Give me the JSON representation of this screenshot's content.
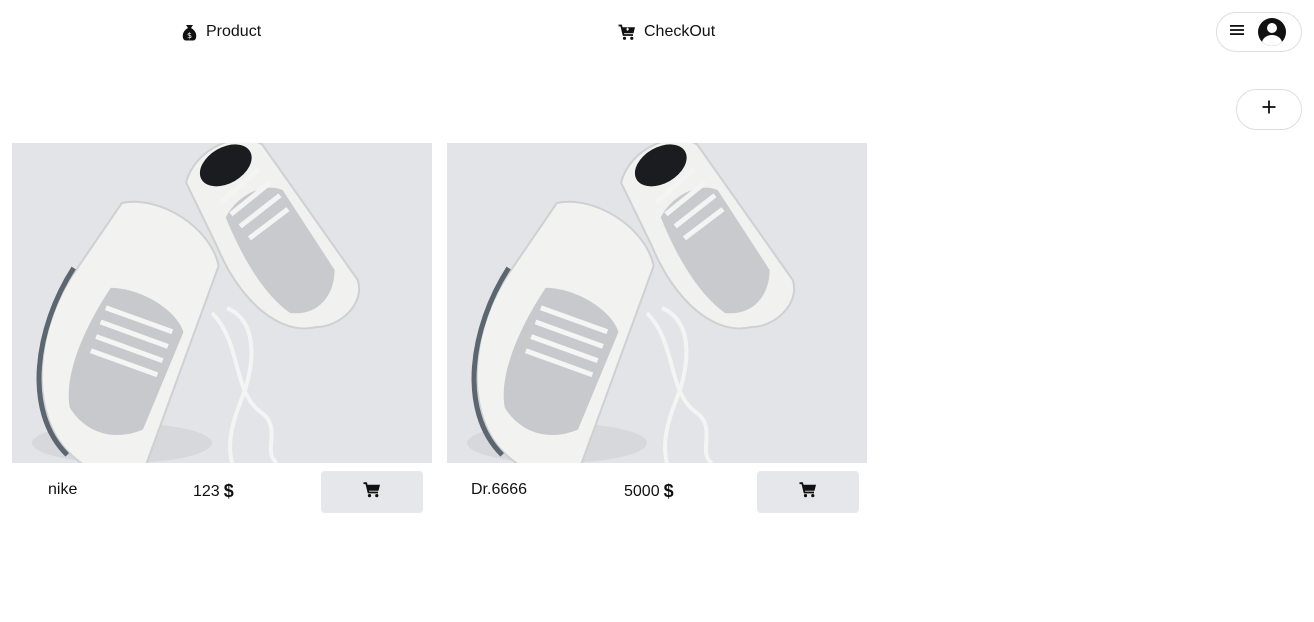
{
  "nav": {
    "product_label": "Product",
    "checkout_label": "CheckOut",
    "product_icon": "money-bag-icon",
    "checkout_icon": "cart-icon"
  },
  "user_menu": {
    "menu_icon": "hamburger-icon",
    "avatar_icon": "user-avatar-icon"
  },
  "add_button": {
    "icon": "plus-icon"
  },
  "products": [
    {
      "name": "nike",
      "price": "123",
      "currency": "$"
    },
    {
      "name": "Dr.6666",
      "price": "5000",
      "currency": "$"
    }
  ],
  "colors": {
    "text": "#111111",
    "cart_button_bg": "#e6e7eb",
    "image_bg": "#e3e4e7",
    "border": "#dedede"
  }
}
